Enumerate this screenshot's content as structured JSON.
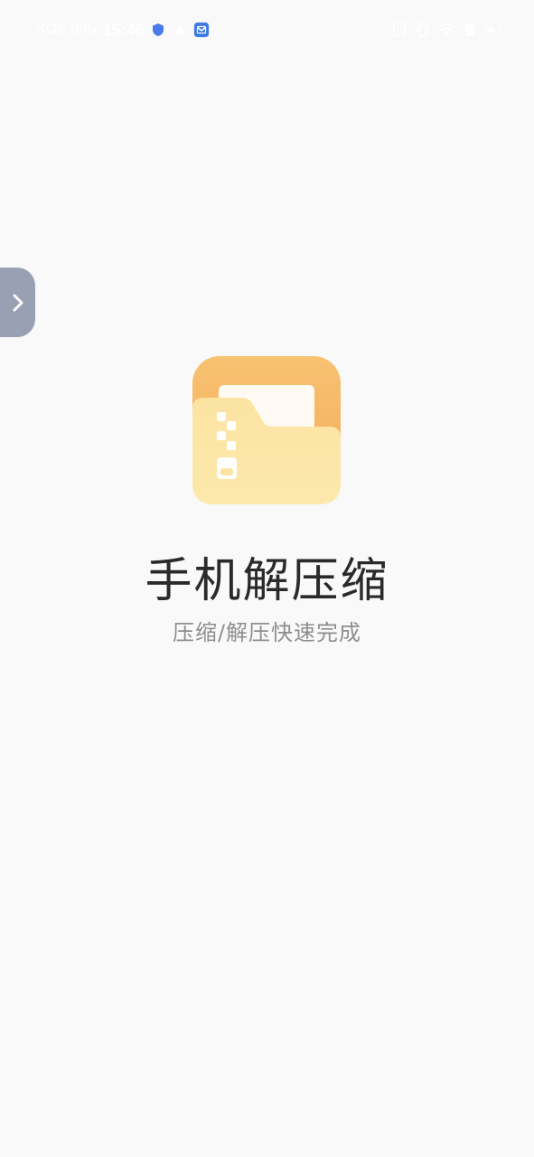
{
  "status_bar": {
    "carrier": "SOS only",
    "time": "15:46"
  },
  "splash": {
    "title": "手机解压缩",
    "subtitle": "压缩/解压快速完成"
  },
  "icons": {
    "side_handle": "chevron-right-icon",
    "app": "zip-folder-icon"
  },
  "colors": {
    "background": "#f9f9f9",
    "handle": "#9aa0b3",
    "icon_top": "#f5b668",
    "icon_folder": "#fbe09a",
    "title": "#2a2a2a",
    "subtitle": "#8e8e8e"
  }
}
